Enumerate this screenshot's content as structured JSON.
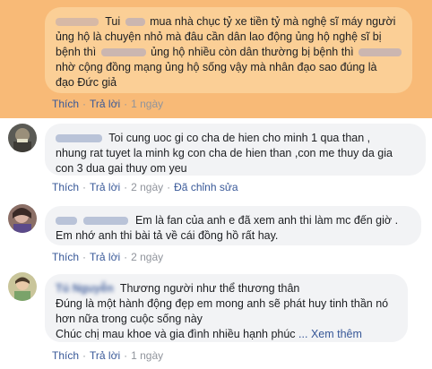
{
  "comments": [
    {
      "lines": [
        [
          "Tui",
          "mua nhà chục tỷ xe tiền tỷ mà nghệ sĩ máy người"
        ],
        [
          "ủng hộ là chuyện nhỏ mà đâu cần dân lao động ủng hộ nghệ sĩ bị"
        ],
        [
          "bệnh thì",
          "ủng hộ nhiều còn dân thường bị bệnh thì"
        ],
        [
          "nhờ cộng đồng mạng ủng hộ sống vậy mà nhân đạo sao đúng là"
        ],
        [
          "đạo Đức giả"
        ]
      ],
      "like": "Thích",
      "reply": "Trả lời",
      "time": "1 ngày"
    },
    {
      "lines": [
        "Toi cung uoc gi co cha de hien cho minh 1 qua than ,",
        "nhung rat tuyet la minh kg con cha de hien than ,con me thuy da gia",
        "con 3 dua gai thuy om yeu"
      ],
      "like": "Thích",
      "reply": "Trả lời",
      "time": "2 ngày",
      "edited": "Đã chỉnh sửa"
    },
    {
      "lines": [
        "Em là fan của anh e đã xem anh thi làm mc đến giờ .",
        "Em nhớ anh thi bài tả về cái đồng hồ rất hay."
      ],
      "like": "Thích",
      "reply": "Trả lời",
      "time": "2 ngày"
    },
    {
      "name": "Tú Nguyễn",
      "lines": [
        "Thương người như thể thương thân",
        "Đúng là một hành động đẹp em mong anh sẽ phát huy tinh thần nó",
        "hơn nữa trong cuộc sống này",
        "Chúc chị mau khoe và gia đình nhiều hạnh phúc"
      ],
      "see_more": "... Xem thêm",
      "like": "Thích",
      "reply": "Trả lời",
      "time": "1 ngày"
    }
  ],
  "colors": {
    "highlight_band": "#f8ba77",
    "link": "#385898",
    "bubble": "#f2f3f5"
  }
}
